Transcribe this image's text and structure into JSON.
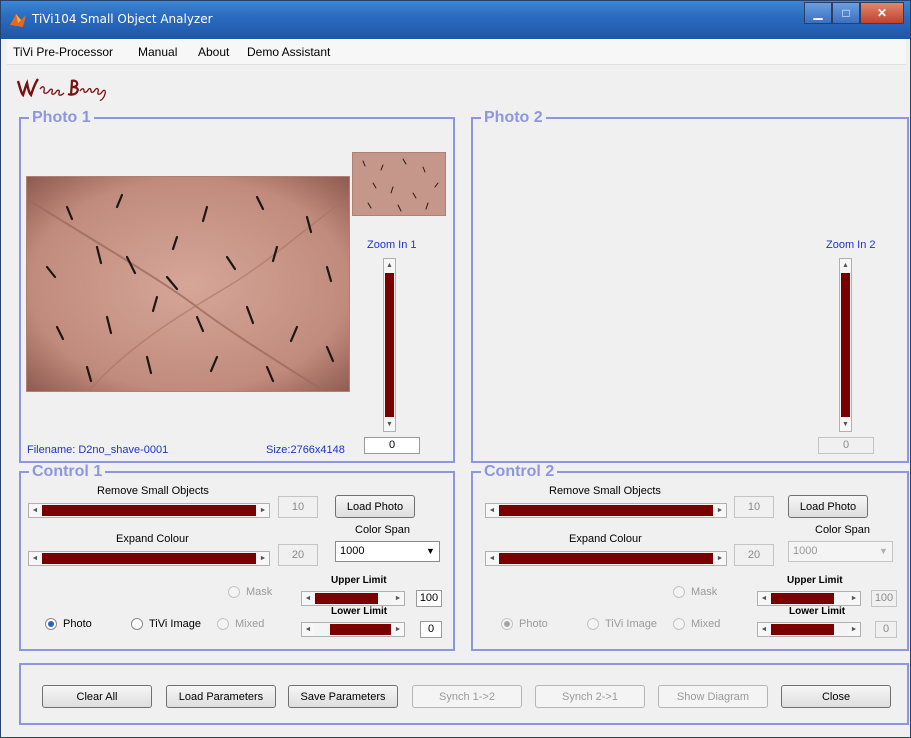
{
  "window": {
    "title": "TiVi104 Small Object Analyzer",
    "minimize": "▁",
    "maximize": "□",
    "close": "✕"
  },
  "menu": [
    "TiVi Pre-Processor",
    "Manual",
    "About",
    "Demo Assistant"
  ],
  "logo": "WheatonBridge",
  "photo1": {
    "title": "Photo 1",
    "zoom_label": "Zoom In 1",
    "zoom_value": "0",
    "filename": "Filename: D2no_shave-0001",
    "size": "Size:2766x4148"
  },
  "photo2": {
    "title": "Photo 2",
    "zoom_label": "Zoom In 2",
    "zoom_value": "0"
  },
  "control1": {
    "title": "Control 1",
    "remove_label": "Remove Small Objects",
    "remove_value": "10",
    "expand_label": "Expand Colour",
    "expand_value": "20",
    "load_photo": "Load Photo",
    "color_span_label": "Color Span",
    "color_span_value": "1000",
    "upper_label": "Upper Limit",
    "upper_value": "100",
    "lower_label": "Lower Limit",
    "lower_value": "0",
    "mask": "Mask",
    "photo": "Photo",
    "tivi": "TiVi Image",
    "mixed": "Mixed"
  },
  "control2": {
    "title": "Control 2",
    "remove_label": "Remove Small Objects",
    "remove_value": "10",
    "expand_label": "Expand Colour",
    "expand_value": "20",
    "load_photo": "Load Photo",
    "color_span_label": "Color Span",
    "color_span_value": "1000",
    "upper_label": "Upper Limit",
    "upper_value": "100",
    "lower_label": "Lower Limit",
    "lower_value": "0",
    "mask": "Mask",
    "photo": "Photo",
    "tivi": "TiVi Image",
    "mixed": "Mixed"
  },
  "bottom": {
    "clear_all": "Clear All",
    "load_params": "Load Parameters",
    "save_params": "Save Parameters",
    "synch12": "Synch 1->2",
    "synch21": "Synch 2->1",
    "show_diagram": "Show Diagram",
    "close": "Close"
  },
  "arrows": {
    "left": "◄",
    "right": "►",
    "up": "▲",
    "down": "▼",
    "dropdown": "▼"
  },
  "colors": {
    "accent": "#8e96e2",
    "label_blue": "#1b35c6",
    "slider_track": "#7a0000"
  }
}
